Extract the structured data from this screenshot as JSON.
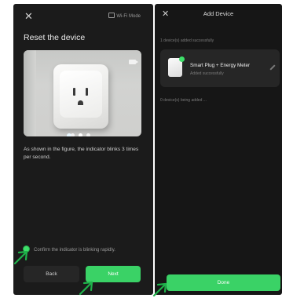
{
  "screen1": {
    "close_icon": "close-icon",
    "wifi_mode_label": "Wi-Fi Mode",
    "title": "Reset the device",
    "description": "As shown in the figure, the indicator blinks 3 times per second.",
    "confirm_text": "Confirm the indicator is blinking rapidly.",
    "back_label": "Back",
    "next_label": "Next",
    "carousel_index": 1,
    "carousel_count": 3
  },
  "screen2": {
    "title": "Add Device",
    "added_caption": "1 device(s) added successfully",
    "device_name": "Smart Plug + Energy Meter",
    "device_status": "Added successfully",
    "being_added_caption": "0 device(s) being added ...",
    "done_label": "Done"
  },
  "colors": {
    "accent_green": "#3ad266",
    "annotation_arrow": "#1fb24a",
    "background": "#1b1b1b"
  }
}
